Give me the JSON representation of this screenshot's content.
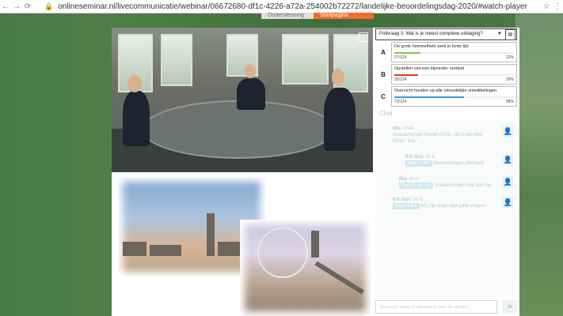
{
  "browser": {
    "back_icon": "arrow-left-icon",
    "forward_icon": "arrow-right-icon",
    "reload_icon": "reload-icon",
    "lock_icon": "lock-icon",
    "url": "onlineseminar.nl/livecommunicatie/webinar/06672680-df1c-4226-a72a-254002b72272/landelijke-beoordelingsdag-2020/#watch-player",
    "bookmark_icon": "star-icon",
    "menu_icon": "more-icon"
  },
  "tabs": {
    "first": "Ondersteuning",
    "second": "Startpagina"
  },
  "poll": {
    "question": "Pollvraag 3: Wat is je meest complexe uitdaging?",
    "options": [
      {
        "letter": "A",
        "text": "De grote hoeveelheid werk in korte tijd",
        "count": "27/124",
        "percent": "22%",
        "value": 22,
        "color": "#8bc34a"
      },
      {
        "letter": "B",
        "text": "Opstellen van een bijzonder oordeel",
        "count": "25/124",
        "percent": "20%",
        "value": 20,
        "color": "#e23a1f"
      },
      {
        "letter": "C",
        "text": "Overzicht houden op alle inhoudelijke ontwikkelingen",
        "count": "72/124",
        "percent": "58%",
        "value": 58,
        "color": "#2a9fd6"
      }
    ]
  },
  "chat": {
    "title": "Chat",
    "messages": [
      {
        "name": "Ilka",
        "time": "09:40",
        "text": "Goedemorgen Mariel of Kiki, dit is een test. Groet, Ilka"
      },
      {
        "name": "Kin Sun",
        "time": "09:41",
        "tag": "Reply to Ilka",
        "text": "Goedemorgen allemaal!"
      },
      {
        "name": "Ilka",
        "time": "09:41",
        "tag": "Reply to Kin Sun",
        "text": "Goedemorgen ook van mij."
      },
      {
        "name": "Kin Sun",
        "time": "09:42",
        "tag": "Reply to Ilka",
        "text": "Wij zijn klaar voor jullie vragen!"
      }
    ],
    "input_placeholder": "Stuur een vraag of opmerking naar de spreker...",
    "send_icon": "send-icon",
    "avatar_icon": "user-icon"
  }
}
